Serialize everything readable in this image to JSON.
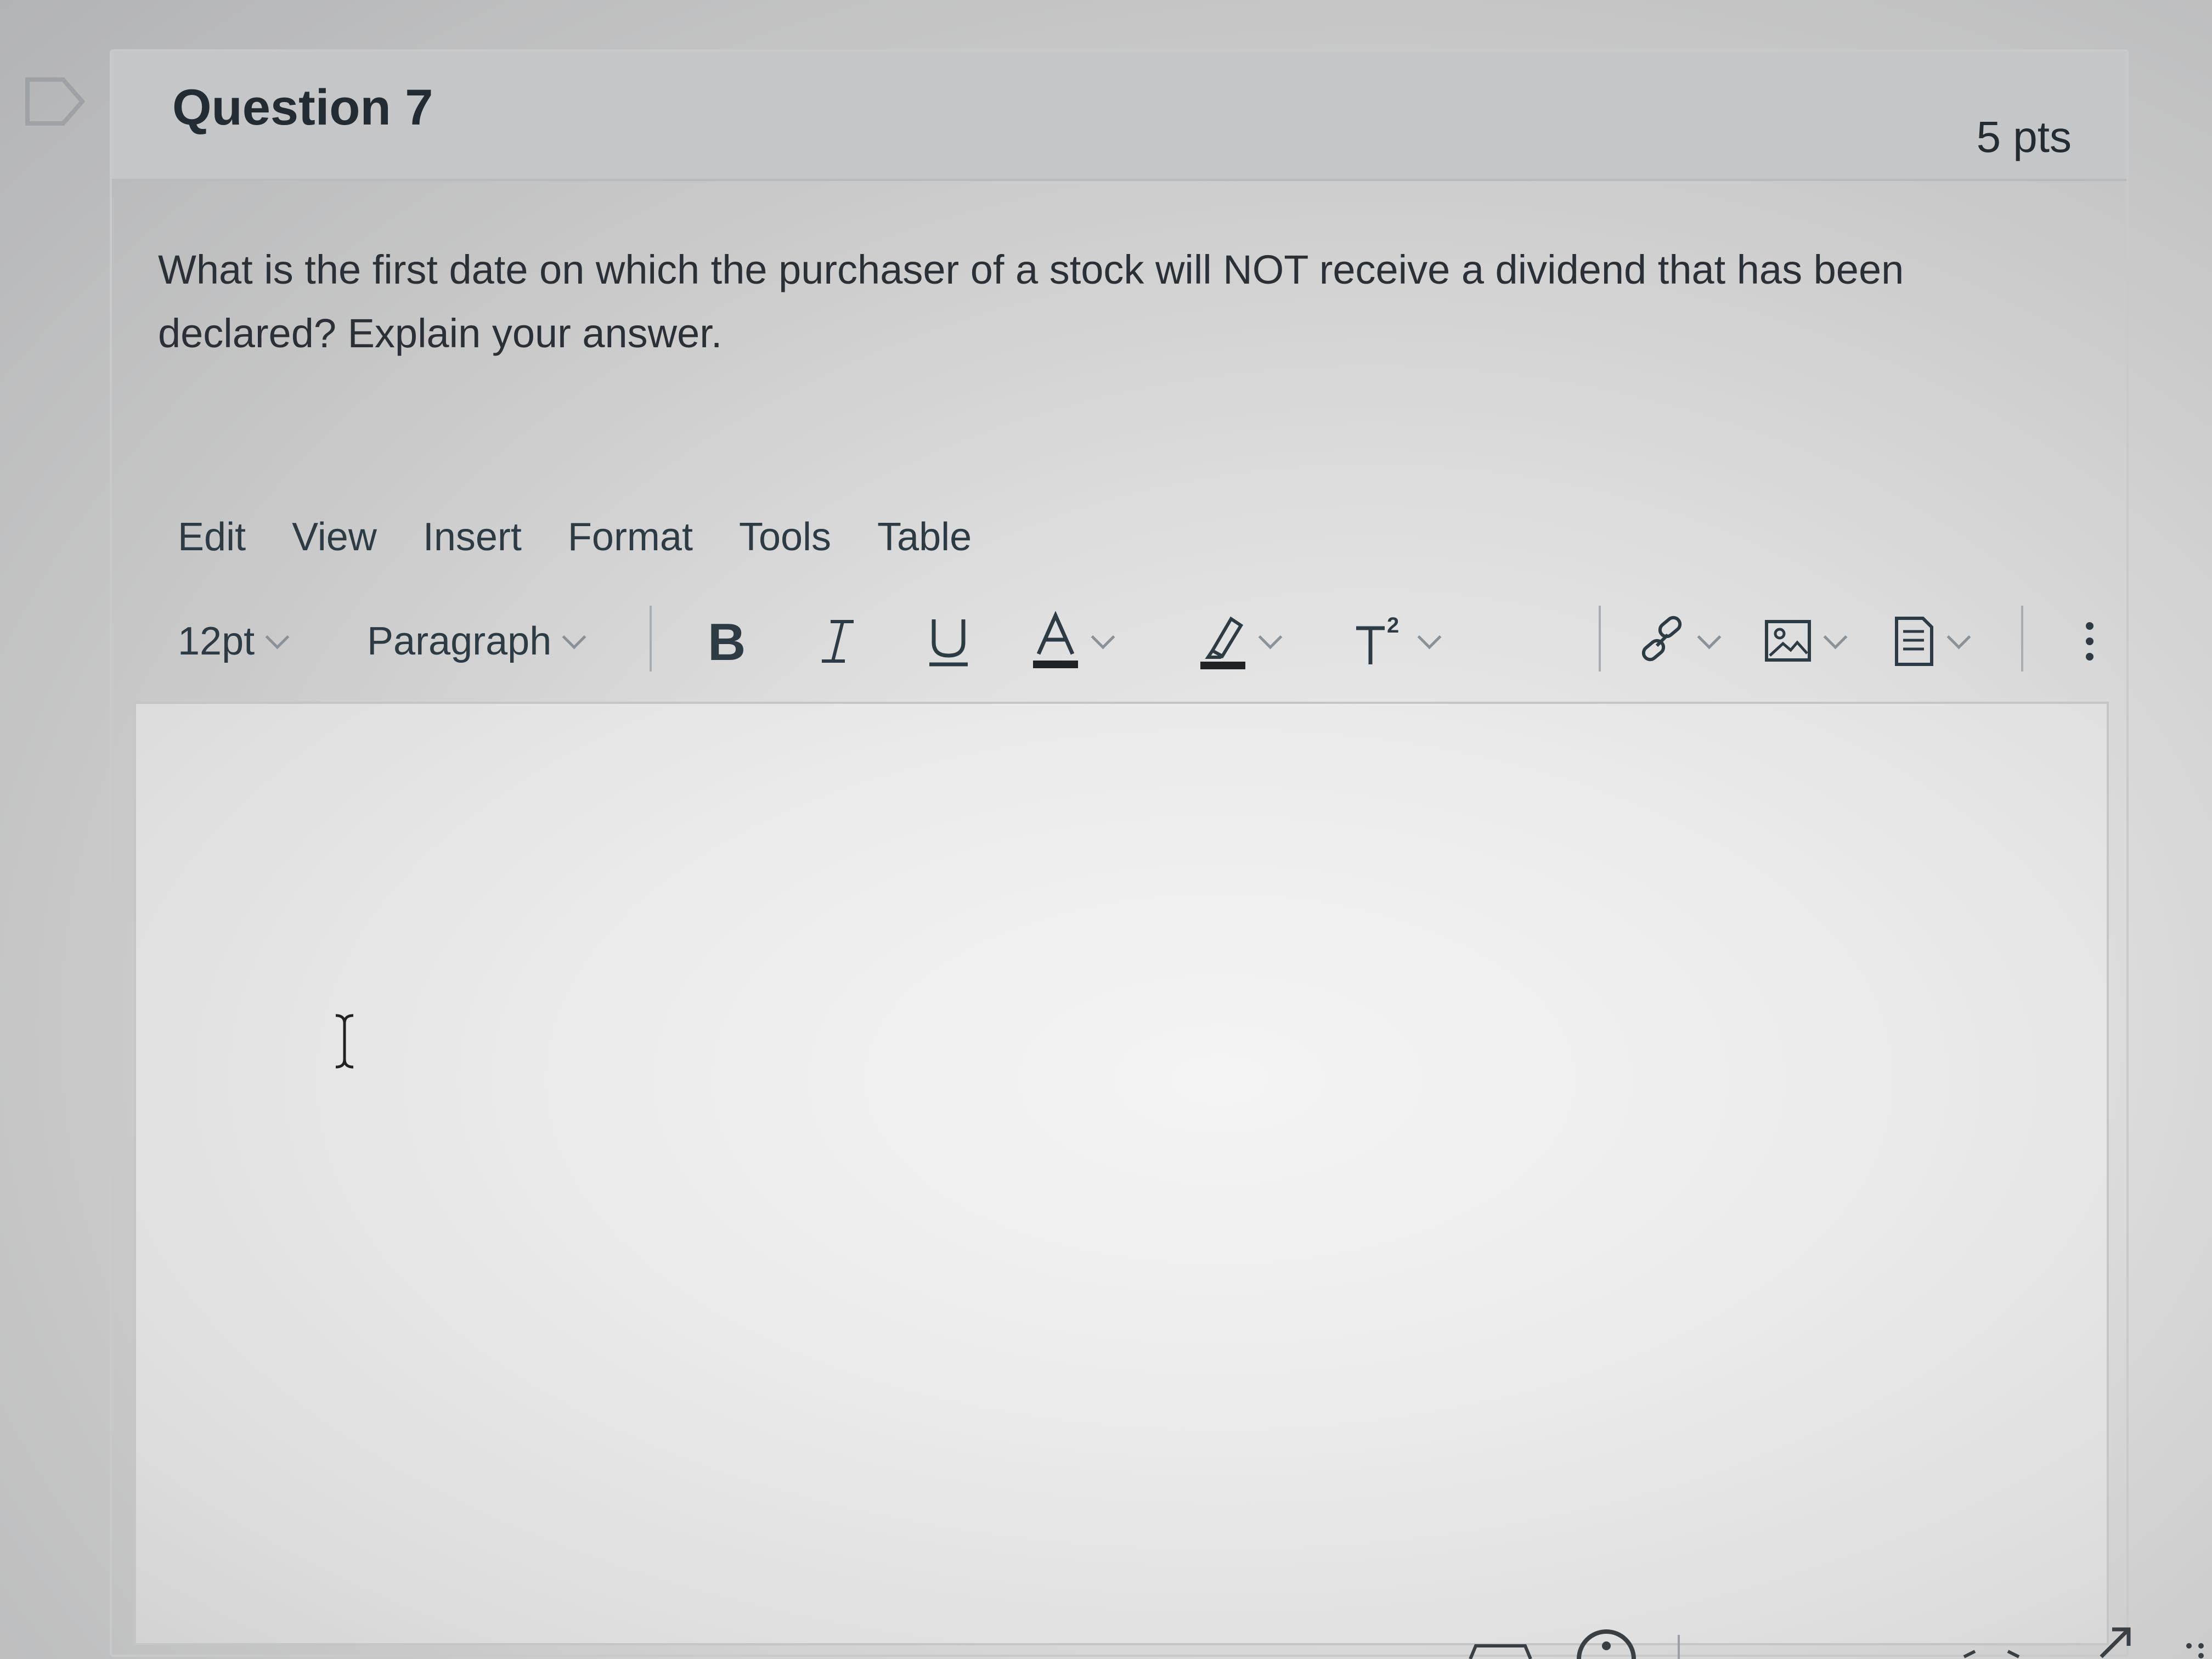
{
  "question": {
    "title": "Question 7",
    "points": "5 pts",
    "text": "What is the first date on which the purchaser of a stock will NOT receive a dividend that has been declared? Explain your answer."
  },
  "editor": {
    "menu": [
      "Edit",
      "View",
      "Insert",
      "Format",
      "Tools",
      "Table"
    ],
    "font_size": "12pt",
    "block_format": "Paragraph",
    "toolbar_icons": {
      "bold": "bold-icon",
      "italic": "italic-icon",
      "underline": "underline-icon",
      "text_color": "text-color-icon",
      "highlight": "highlight-icon",
      "superscript": "superscript-icon",
      "link": "link-icon",
      "image": "image-icon",
      "document": "document-icon",
      "more": "more-options-icon"
    },
    "content": ""
  },
  "colors": {
    "text": "#2d3b45",
    "header_bg": "#c5c6c8",
    "editor_bg": "#ececec"
  }
}
